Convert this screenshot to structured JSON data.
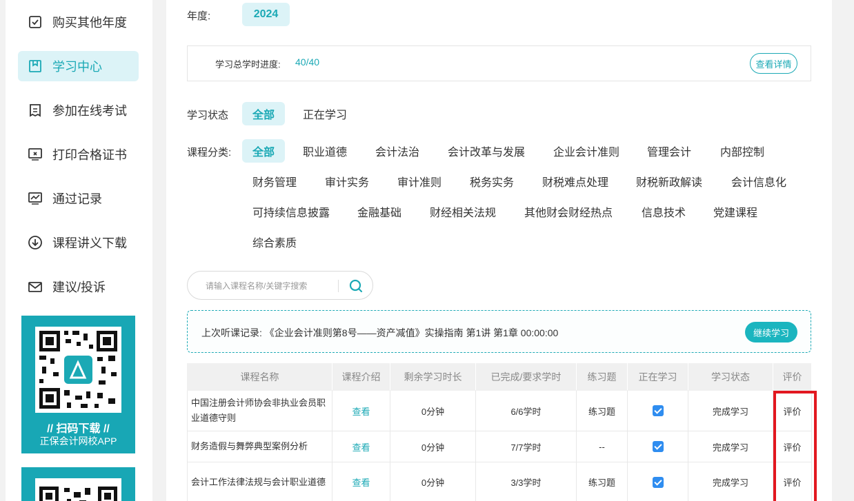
{
  "sidebar": {
    "items": [
      {
        "label": "购买其他年度",
        "icon": "checkbox-icon"
      },
      {
        "label": "学习中心",
        "icon": "bookmark-icon"
      },
      {
        "label": "参加在线考试",
        "icon": "document-icon"
      },
      {
        "label": "打印合格证书",
        "icon": "monitor-icon"
      },
      {
        "label": "通过记录",
        "icon": "chart-icon"
      },
      {
        "label": "课程讲义下载",
        "icon": "download-icon"
      },
      {
        "label": "建议/投诉",
        "icon": "mail-icon"
      }
    ],
    "qr": {
      "title": "// 扫码下载 //",
      "subtitle": "正保会计网校APP"
    }
  },
  "main": {
    "year_label": "年度:",
    "year_value": "2024",
    "progress": {
      "label": "学习总学时进度:",
      "value": "40/40",
      "detail_button": "查看详情"
    },
    "status_filter": {
      "label": "学习状态",
      "options": [
        "全部",
        "正在学习"
      ]
    },
    "category_filter": {
      "label": "课程分类:",
      "options": [
        "全部",
        "职业道德",
        "会计法治",
        "会计改革与发展",
        "企业会计准则",
        "管理会计",
        "内部控制",
        "财务管理",
        "审计实务",
        "审计准则",
        "税务实务",
        "财税难点处理",
        "财税新政解读",
        "会计信息化",
        "可持续信息披露",
        "金融基础",
        "财经相关法规",
        "其他财会财经热点",
        "信息技术",
        "党建课程",
        "综合素质"
      ]
    },
    "search": {
      "placeholder": "请输入课程名称/关键字搜索"
    },
    "last_record": {
      "text": "上次听课记录: 《企业会计准则第8号——资产减值》实操指南 第1讲 第1章 00:00:00",
      "button": "继续学习"
    },
    "table": {
      "headers": [
        "课程名称",
        "课程介绍",
        "剩余学习时长",
        "已完成/要求学时",
        "练习题",
        "正在学习",
        "学习状态",
        "评价"
      ],
      "rows": [
        {
          "name": "中国注册会计师协会非执业会员职业道德守则",
          "intro": "查看",
          "remaining": "0分钟",
          "hours": "6/6学时",
          "exercise": "练习题",
          "learning": true,
          "status": "完成学习",
          "review": "评价"
        },
        {
          "name": "财务造假与舞弊典型案例分析",
          "intro": "查看",
          "remaining": "0分钟",
          "hours": "7/7学时",
          "exercise": "--",
          "learning": true,
          "status": "完成学习",
          "review": "评价"
        },
        {
          "name": "会计工作法律法规与会计职业道德",
          "intro": "查看",
          "remaining": "0分钟",
          "hours": "3/3学时",
          "exercise": "练习题",
          "learning": true,
          "status": "完成学习",
          "review": "评价"
        }
      ]
    }
  },
  "colors": {
    "accent": "#1ba9b5",
    "highlight": "#e21820",
    "checkbox": "#2f8df0"
  }
}
